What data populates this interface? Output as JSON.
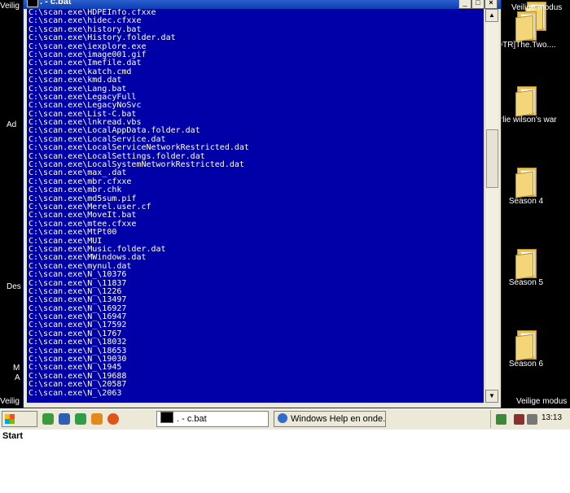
{
  "window": {
    "title": ". - c.bat",
    "buttons": [
      "_",
      "□",
      "×"
    ],
    "scrollbar": {
      "up": "▲",
      "down": "▼"
    }
  },
  "console_lines": [
    "C:\\scan.exe\\HDPEInfo.cfxxe",
    "C:\\scan.exe\\hidec.cfxxe",
    "C:\\scan.exe\\history.bat",
    "C:\\scan.exe\\History.folder.dat",
    "C:\\scan.exe\\iexplore.exe",
    "C:\\scan.exe\\image001.gif",
    "C:\\scan.exe\\Imefile.dat",
    "C:\\scan.exe\\katch.cmd",
    "C:\\scan.exe\\kmd.dat",
    "C:\\scan.exe\\Lang.bat",
    "C:\\scan.exe\\LegacyFull",
    "C:\\scan.exe\\LegacyNoSvc",
    "C:\\scan.exe\\List-C.bat",
    "C:\\scan.exe\\lnkread.vbs",
    "C:\\scan.exe\\LocalAppData.folder.dat",
    "C:\\scan.exe\\LocalService.dat",
    "C:\\scan.exe\\LocalServiceNetworkRestricted.dat",
    "C:\\scan.exe\\LocalSettings.folder.dat",
    "C:\\scan.exe\\LocalSystemNetworkRestricted.dat",
    "C:\\scan.exe\\max_.dat",
    "C:\\scan.exe\\mbr.cfxxe",
    "C:\\scan.exe\\mbr.chk",
    "C:\\scan.exe\\md5sum.pif",
    "C:\\scan.exe\\Merel.user.cf",
    "C:\\scan.exe\\MoveIt.bat",
    "C:\\scan.exe\\mtee.cfxxe",
    "C:\\scan.exe\\MtPt00",
    "C:\\scan.exe\\MUI",
    "C:\\scan.exe\\Music.folder.dat",
    "C:\\scan.exe\\MWindows.dat",
    "C:\\scan.exe\\mynul.dat",
    "C:\\scan.exe\\N_\\10376",
    "C:\\scan.exe\\N_\\11837",
    "C:\\scan.exe\\N_\\1226",
    "C:\\scan.exe\\N_\\13497",
    "C:\\scan.exe\\N_\\16927",
    "C:\\scan.exe\\N_\\16947",
    "C:\\scan.exe\\N_\\17592",
    "C:\\scan.exe\\N_\\1767",
    "C:\\scan.exe\\N_\\18032",
    "C:\\scan.exe\\N_\\18653",
    "C:\\scan.exe\\N_\\19030",
    "C:\\scan.exe\\N_\\1945",
    "C:\\scan.exe\\N_\\19688",
    "C:\\scan.exe\\N_\\20587",
    "C:\\scan.exe\\N_\\2063"
  ],
  "desktop": {
    "left_edge": [
      "Veilig",
      "Ad",
      "Des",
      "M",
      "A",
      "Veilig"
    ],
    "icons": [
      {
        "label": "Veilige modus",
        "icon": "folder-icon"
      },
      {
        "label": "OTR]The.Two....",
        "icon": "folder-icon"
      },
      {
        "label": "arlie wilson's war",
        "icon": "folder-icon"
      },
      {
        "label": "Season 4",
        "icon": "folder-icon"
      },
      {
        "label": "Season 5",
        "icon": "folder-icon"
      },
      {
        "label": "Season 6",
        "icon": "folder-icon"
      },
      {
        "label": "Veilige modus",
        "icon": "none"
      }
    ]
  },
  "taskbar": {
    "start_label": "Start",
    "tasks": [
      {
        "label": ". - c.bat",
        "icon": "console-icon"
      },
      {
        "label": "Windows Help en onde...",
        "icon": "help-icon"
      }
    ],
    "clock": "13:13"
  },
  "colors": {
    "console_bg": "#0000A8",
    "console_fg": "#FFFFFF",
    "titlebar": "#0A3FB4",
    "taskbar": "#ECE9D8"
  }
}
